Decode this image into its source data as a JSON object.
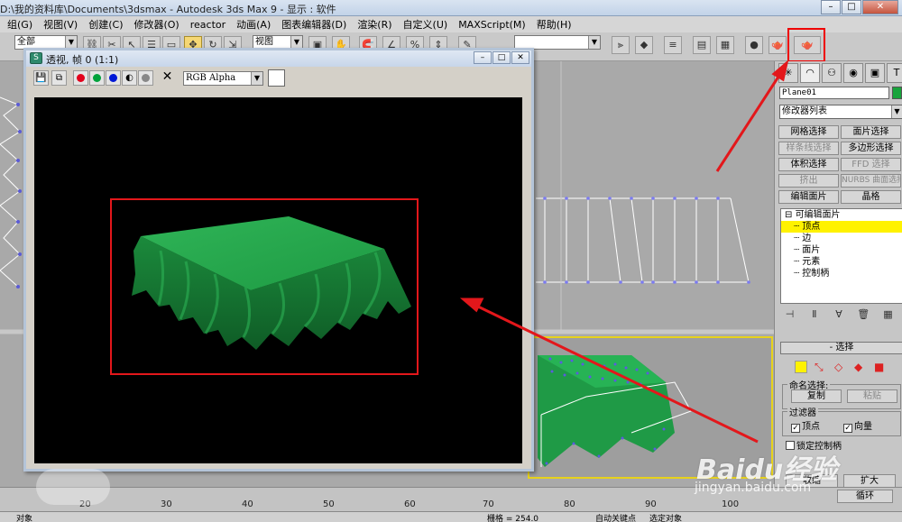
{
  "app": {
    "title": "D:\\我的资料库\\Documents\\3dsmax     - Autodesk 3ds Max 9     - 显示 : 软件",
    "window_buttons": [
      "–",
      "□",
      "✕"
    ]
  },
  "menu": [
    "组(G)",
    "视图(V)",
    "创建(C)",
    "修改器(O)",
    "reactor",
    "动画(A)",
    "图表编辑器(D)",
    "渲染(R)",
    "自定义(U)",
    "MAXScript(M)",
    "帮助(H)"
  ],
  "toolbar": {
    "selection_filter": "全部",
    "ref_coord": "视图",
    "named_sets": "",
    "icons": [
      "undo-icon",
      "redo-icon",
      "select-link-icon",
      "unlink-icon",
      "bind-spacewarp-icon",
      "select-icon",
      "select-by-name-icon",
      "rect-region-icon",
      "window-crossing-icon",
      "move-icon",
      "rotate-icon",
      "scale-icon",
      "pivot-icon",
      "manipulate-icon",
      "snap-icon",
      "angle-snap-icon",
      "percent-snap-icon",
      "spinner-snap-icon",
      "mirror-icon",
      "align-icon",
      "layer-icon",
      "curve-editor-icon",
      "material-editor-icon",
      "render-setup-icon",
      "quick-render-icon"
    ]
  },
  "render_window": {
    "title": "透视, 帧 0 (1:1)",
    "channel": "RGB Alpha",
    "colors": {
      "red": "#e3001b",
      "green": "#00a23b",
      "blue": "#0018d6",
      "cloth": "#1a9a3f"
    }
  },
  "command_panel": {
    "object_name": "Plane01",
    "object_color": "#17a43b",
    "modifier_list": "修改器列表",
    "buttons": [
      [
        "网格选择",
        "面片选择"
      ],
      [
        "样条线选择",
        "多边形选择"
      ],
      [
        "体积选择",
        "FFD 选择"
      ],
      [
        "挤出",
        "NURBS 曲面选择"
      ],
      [
        "编辑面片",
        "晶格"
      ]
    ],
    "disabled": [
      "样条线选择",
      "FFD 选择",
      "挤出",
      "NURBS 曲面选择"
    ],
    "stack": {
      "root": "可编辑面片",
      "items": [
        "顶点",
        "边",
        "面片",
        "元素",
        "控制柄"
      ],
      "selected": "顶点"
    },
    "selection": {
      "rollout": "选择",
      "named_sel_label": "命名选择:",
      "copy": "复制",
      "paste": "粘贴",
      "filter_label": "过滤器",
      "vertex": "顶点",
      "vector": "向量",
      "lock_handles": "锁定控制柄",
      "shrink": "收缩",
      "grow": "扩大",
      "loop": "循环"
    }
  },
  "timeline": {
    "ticks": [
      "20",
      "30",
      "40",
      "50",
      "60",
      "70",
      "80",
      "90",
      "100"
    ]
  },
  "statusbar": {
    "object": "对象",
    "grid": "栅格 = 254.0",
    "auto_key": "自动关键点",
    "selected": "选定对象"
  },
  "watermark": {
    "text": "Baidu经验",
    "url": "jingyan.baidu.com"
  }
}
